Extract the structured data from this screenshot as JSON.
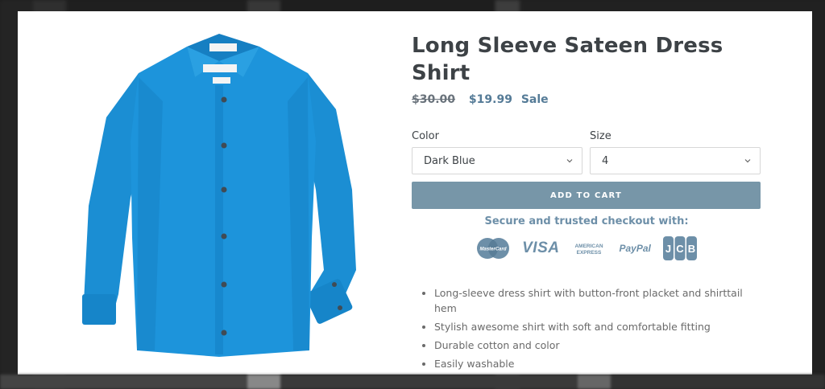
{
  "product": {
    "title": "Long Sleeve Sateen Dress Shirt",
    "price_old": "$30.00",
    "price_sale": "$19.99",
    "sale_label": "Sale",
    "image_icon": "shirt-image"
  },
  "options": {
    "color_label": "Color",
    "color_value": "Dark Blue",
    "size_label": "Size",
    "size_value": "4"
  },
  "cart": {
    "button_label": "ADD TO CART"
  },
  "checkout": {
    "secure_text": "Secure and trusted checkout with:",
    "payment_methods": [
      "MasterCard",
      "VISA",
      "AMERICAN EXPRESS",
      "PayPal",
      "JCB"
    ]
  },
  "features": [
    "Long-sleeve dress shirt with button-front placket and shirttail hem",
    "Stylish awesome shirt with soft and comfortable fitting",
    "Durable cotton and color",
    "Easily washable"
  ],
  "colors": {
    "button_bg": "#7796a8",
    "accent": "#557b97",
    "payment": "#6d8fa8",
    "shirt": "#1a8fd6"
  }
}
